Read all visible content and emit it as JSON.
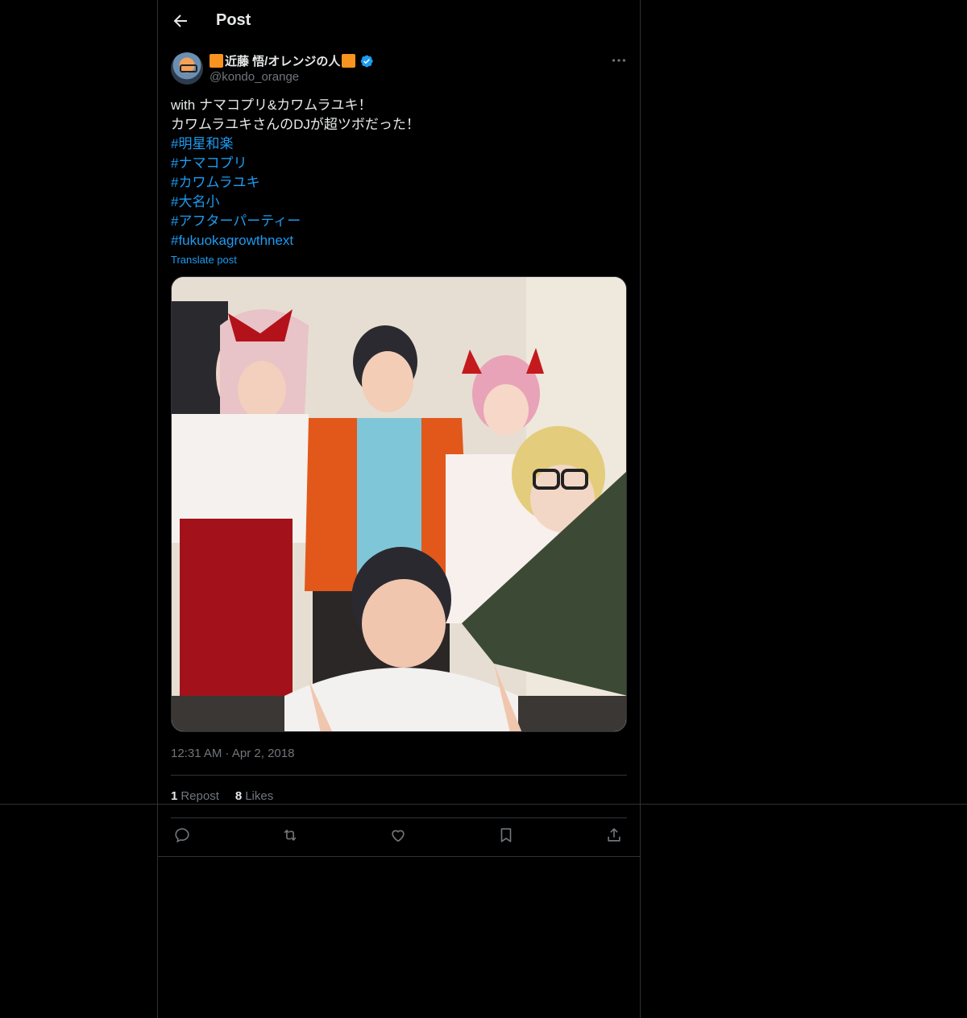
{
  "header": {
    "back_icon": "arrow-left-icon",
    "title": "Post"
  },
  "author": {
    "name_prefix_emoji": "orange-square",
    "name": "近藤 悟/オレンジの人",
    "name_suffix_emoji": "orange-square",
    "handle": "@kondo_orange",
    "verified": true
  },
  "post": {
    "lines": [
      "with ナマコプリ&カワムラユキ！",
      "カワムラユキさんのDJが超ツボだった！"
    ],
    "hashtags": [
      "#明星和楽",
      "#ナマコプリ",
      "#カワムラユキ",
      "#大名小",
      "#アフターパーティー",
      "#fukuokagrowthnext"
    ],
    "translate_label": "Translate post",
    "timestamp": "12:31 AM · Apr 2, 2018"
  },
  "stats": {
    "reposts_count": "1",
    "reposts_label": "Repost",
    "likes_count": "8",
    "likes_label": "Likes"
  },
  "actions": [
    "reply-icon",
    "repost-icon",
    "like-icon",
    "bookmark-icon",
    "share-icon"
  ],
  "colors": {
    "background": "#000000",
    "text": "#e7e9ea",
    "muted": "#71767b",
    "accent": "#1d9bf0",
    "border": "#2f3336",
    "brand_orange": "#f7931e"
  }
}
